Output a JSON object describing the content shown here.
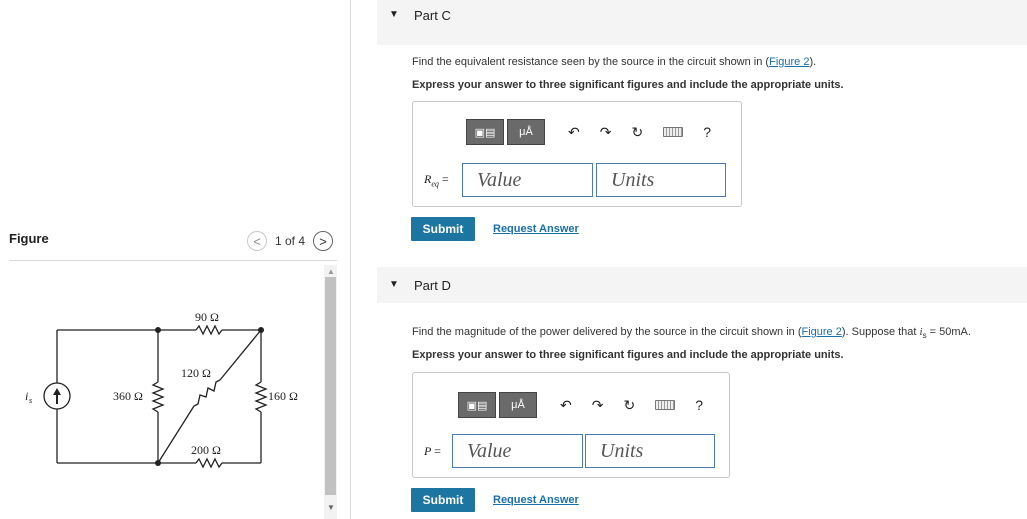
{
  "left": {
    "figure_label": "Figure",
    "pager": {
      "prev": "<",
      "count": "1 of 4",
      "next": ">"
    }
  },
  "circuit": {
    "source_label": "i",
    "source_sub": "s",
    "r_top": "90 Ω",
    "r_diag": "120 Ω",
    "r_left": "360 Ω",
    "r_right": "160 Ω",
    "r_bottom": "200 Ω"
  },
  "partC": {
    "title": "Part C",
    "question_pre": "Find the equivalent resistance seen by the source in the circuit shown in (",
    "question_link": "Figure 2",
    "question_post": ").",
    "instruction": "Express your answer to three significant figures and include the appropriate units.",
    "var_main": "R",
    "var_sub": "eq",
    "equals": "=",
    "value_placeholder": "Value",
    "units_placeholder": "Units",
    "submit": "Submit",
    "request": "Request Answer"
  },
  "partD": {
    "title": "Part D",
    "question_pre": "Find the magnitude of the power delivered by the source in the circuit shown in (",
    "question_link": "Figure 2",
    "question_post": "). Suppose that ",
    "question_var": "i",
    "question_var_sub": "s",
    "question_tail": " = 50mA.",
    "instruction": "Express your answer to three significant figures and include the appropriate units.",
    "var_main": "P",
    "equals": "=",
    "value_placeholder": "Value",
    "units_placeholder": "Units",
    "submit": "Submit",
    "request": "Request Answer"
  },
  "toolbar": {
    "mu_label": "μÅ",
    "help": "?"
  },
  "icons": [
    "templates-icon",
    "units-icon",
    "undo-icon",
    "redo-icon",
    "reset-icon",
    "keyboard-icon",
    "help-icon",
    "expand-arrow-icon",
    "chevron-left-icon",
    "chevron-right-icon"
  ]
}
